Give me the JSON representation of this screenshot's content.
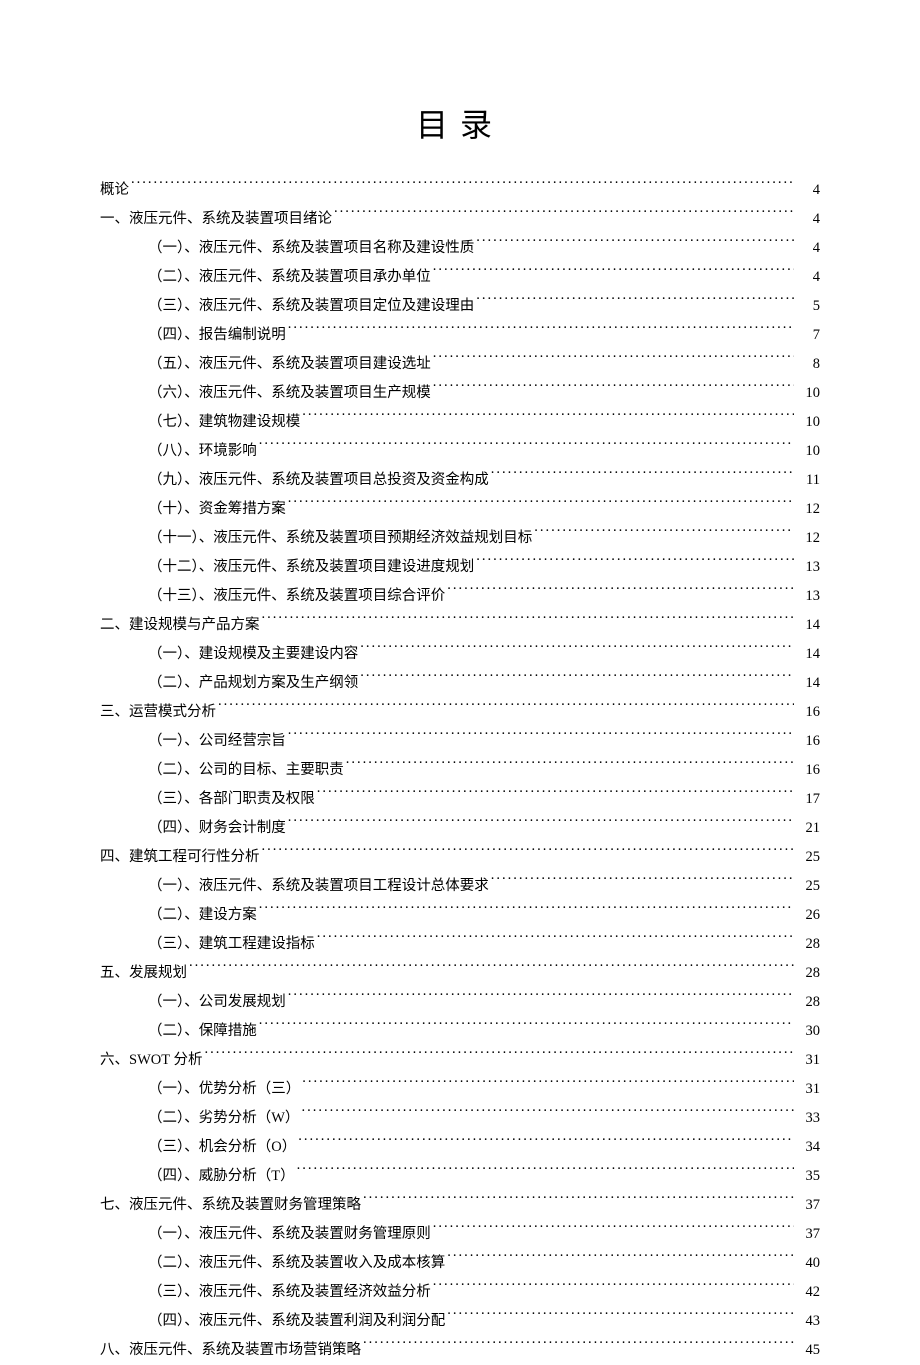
{
  "title": "目录",
  "toc": [
    {
      "level": 0,
      "label": "概论",
      "page": "4"
    },
    {
      "level": 0,
      "label": "一、液压元件、系统及装置项目绪论",
      "page": "4"
    },
    {
      "level": 1,
      "label": "（一）、液压元件、系统及装置项目名称及建设性质",
      "page": "4"
    },
    {
      "level": 1,
      "label": "（二）、液压元件、系统及装置项目承办单位",
      "page": "4"
    },
    {
      "level": 1,
      "label": "（三）、液压元件、系统及装置项目定位及建设理由",
      "page": "5"
    },
    {
      "level": 1,
      "label": "（四）、报告编制说明",
      "page": "7"
    },
    {
      "level": 1,
      "label": "（五）、液压元件、系统及装置项目建设选址",
      "page": "8"
    },
    {
      "level": 1,
      "label": "（六）、液压元件、系统及装置项目生产规模",
      "page": "10"
    },
    {
      "level": 1,
      "label": "（七）、建筑物建设规模",
      "page": "10"
    },
    {
      "level": 1,
      "label": "（八）、环境影响",
      "page": "10"
    },
    {
      "level": 1,
      "label": "（九）、液压元件、系统及装置项目总投资及资金构成",
      "page": "11"
    },
    {
      "level": 1,
      "label": "（十）、资金筹措方案",
      "page": "12"
    },
    {
      "level": 1,
      "label": "（十一）、液压元件、系统及装置项目预期经济效益规划目标",
      "page": "12"
    },
    {
      "level": 1,
      "label": "（十二）、液压元件、系统及装置项目建设进度规划",
      "page": "13"
    },
    {
      "level": 1,
      "label": "（十三）、液压元件、系统及装置项目综合评价",
      "page": "13"
    },
    {
      "level": 0,
      "label": "二、建设规模与产品方案",
      "page": "14"
    },
    {
      "level": 1,
      "label": "（一）、建设规模及主要建设内容",
      "page": "14"
    },
    {
      "level": 1,
      "label": "（二）、产品规划方案及生产纲领",
      "page": "14"
    },
    {
      "level": 0,
      "label": "三、运营模式分析",
      "page": "16"
    },
    {
      "level": 1,
      "label": "（一）、公司经营宗旨",
      "page": "16"
    },
    {
      "level": 1,
      "label": "（二）、公司的目标、主要职责",
      "page": "16"
    },
    {
      "level": 1,
      "label": "（三）、各部门职责及权限",
      "page": "17"
    },
    {
      "level": 1,
      "label": "（四）、财务会计制度",
      "page": "21"
    },
    {
      "level": 0,
      "label": "四、建筑工程可行性分析",
      "page": "25"
    },
    {
      "level": 1,
      "label": "（一）、液压元件、系统及装置项目工程设计总体要求",
      "page": "25"
    },
    {
      "level": 1,
      "label": "（二）、建设方案",
      "page": "26"
    },
    {
      "level": 1,
      "label": "（三）、建筑工程建设指标",
      "page": "28"
    },
    {
      "level": 0,
      "label": "五、发展规划",
      "page": "28"
    },
    {
      "level": 1,
      "label": "（一）、公司发展规划",
      "page": "28"
    },
    {
      "level": 1,
      "label": "（二）、保障措施",
      "page": "30"
    },
    {
      "level": 0,
      "label": "六、SWOT 分析",
      "page": "31"
    },
    {
      "level": 1,
      "label": "（一）、优势分析（三）",
      "page": "31"
    },
    {
      "level": 1,
      "label": "（二）、劣势分析（W）",
      "page": "33"
    },
    {
      "level": 1,
      "label": "（三）、机会分析（O）",
      "page": "34"
    },
    {
      "level": 1,
      "label": "（四）、威胁分析（T）",
      "page": "35"
    },
    {
      "level": 0,
      "label": "七、液压元件、系统及装置财务管理策略",
      "page": "37"
    },
    {
      "level": 1,
      "label": "（一）、液压元件、系统及装置财务管理原则",
      "page": "37"
    },
    {
      "level": 1,
      "label": "（二）、液压元件、系统及装置收入及成本核算",
      "page": "40"
    },
    {
      "level": 1,
      "label": "（三）、液压元件、系统及装置经济效益分析",
      "page": "42"
    },
    {
      "level": 1,
      "label": "（四）、液压元件、系统及装置利润及利润分配",
      "page": "43"
    },
    {
      "level": 0,
      "label": "八、液压元件、系统及装置市场营销策略",
      "page": "45"
    }
  ]
}
